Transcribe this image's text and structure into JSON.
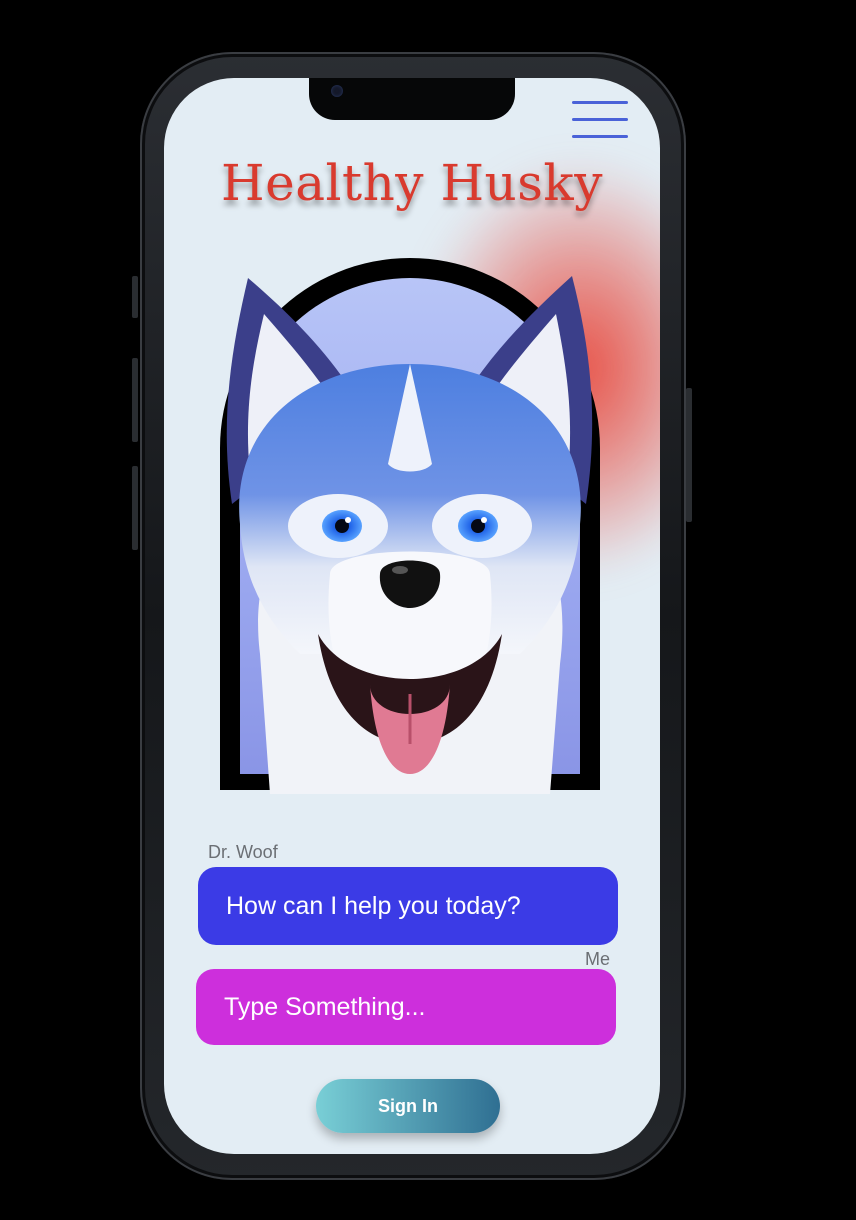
{
  "app": {
    "title": "Healthy Husky"
  },
  "header": {
    "menu_icon": "hamburger-menu-icon"
  },
  "hero": {
    "image": "husky-puppy-illustration"
  },
  "chat": {
    "bot_name": "Dr. Woof",
    "bot_message": "How can I help you today?",
    "user_name": "Me",
    "input_placeholder": "Type Something..."
  },
  "actions": {
    "sign_in_label": "Sign In"
  },
  "colors": {
    "title": "#d93a2e",
    "bot_bubble": "#3b3be6",
    "user_bubble": "#cd2fdc",
    "menu": "#4a62d8",
    "background": "#e3edf4"
  }
}
